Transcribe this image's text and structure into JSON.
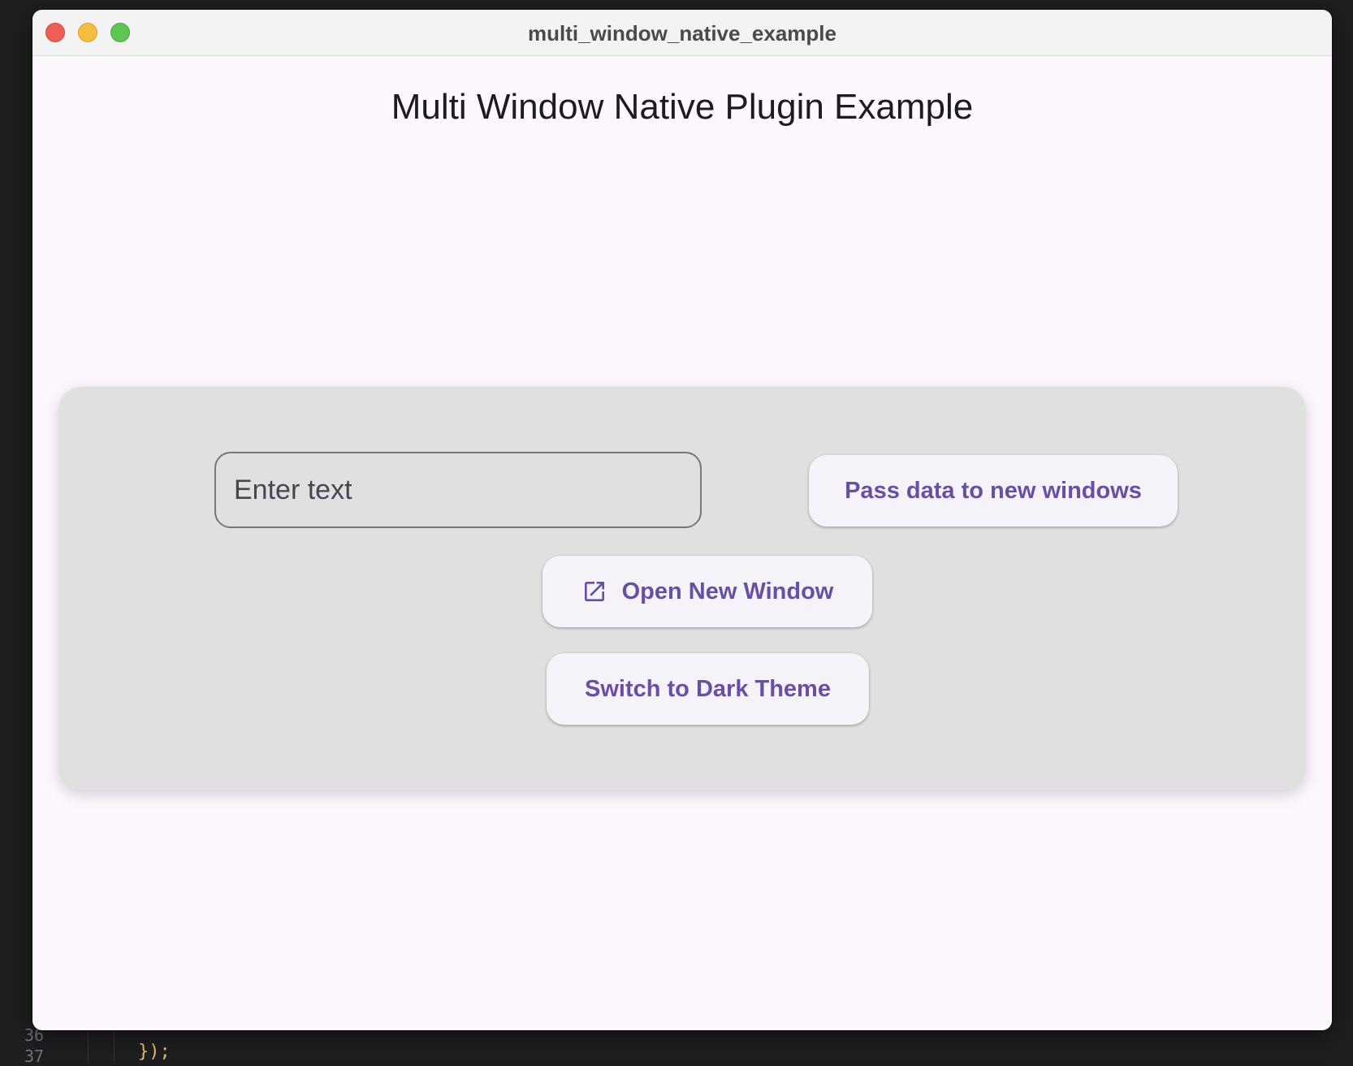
{
  "editor": {
    "gutter_numbers": [
      "36",
      "37"
    ],
    "code_fragment": "});"
  },
  "window": {
    "title": "multi_window_native_example"
  },
  "app": {
    "title": "Multi Window Native Plugin Example",
    "input": {
      "placeholder": "Enter text",
      "value": ""
    },
    "buttons": {
      "pass_data": "Pass data to new windows",
      "open_window": "Open New Window",
      "switch_theme": "Switch to Dark Theme"
    },
    "icons": {
      "open_window": "open-in-new-icon"
    },
    "colors": {
      "accent": "#6750a4",
      "background": "#fdf8fd",
      "card": "#e0e0e0",
      "button_bg": "#f6f2fa"
    }
  }
}
